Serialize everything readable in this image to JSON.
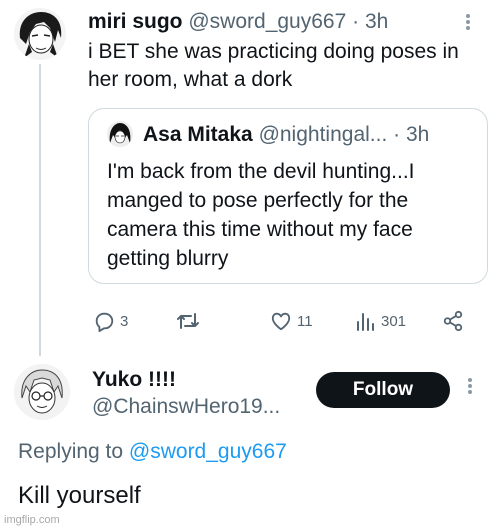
{
  "tweet": {
    "author_name": "miri sugo",
    "handle": "@sword_guy667",
    "separator": "·",
    "time": "3h",
    "text": "i BET she was practicing doing poses in her room, what a dork"
  },
  "quote": {
    "author_name": "Asa Mitaka",
    "handle": "@nightingal...",
    "separator": "·",
    "time": "3h",
    "text": "I'm back from the devil hunting...I manged to pose perfectly for the camera this time without my face getting blurry"
  },
  "actions": {
    "reply_count": "3",
    "like_count": "11",
    "view_count": "301"
  },
  "reply": {
    "author_name": "Yuko !!!!",
    "handle": "@ChainswHero19...",
    "follow_label": "Follow",
    "replying_prefix": "Replying to ",
    "replying_handle": "@sword_guy667",
    "text": "Kill yourself"
  },
  "watermark": "imgflip.com",
  "colors": {
    "link": "#1d9bf0",
    "secondary_text": "#536471",
    "follow_bg": "#0f1419"
  },
  "icons": [
    "reply-icon",
    "retweet-icon",
    "like-icon",
    "views-icon",
    "share-icon",
    "more-icon"
  ]
}
